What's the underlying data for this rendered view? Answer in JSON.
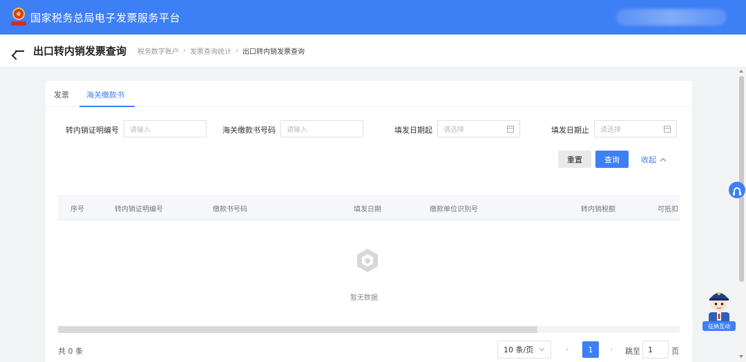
{
  "header": {
    "app_title": "国家税务总局电子发票服务平台"
  },
  "page": {
    "title": "出口转内销发票查询",
    "breadcrumb": [
      "税务数字账户",
      "发票查询统计",
      "出口转内销发票查询"
    ]
  },
  "tabs": [
    {
      "label": "发票",
      "active": false
    },
    {
      "label": "海关缴款书",
      "active": true
    }
  ],
  "filters": {
    "transfer_cert_no": {
      "label": "转内销证明编号",
      "placeholder": "请输入"
    },
    "customs_payment_no": {
      "label": "海关缴款书号码",
      "placeholder": "请输入"
    },
    "issue_date_start": {
      "label": "填发日期起",
      "placeholder": "请选择"
    },
    "issue_date_end": {
      "label": "填发日期止",
      "placeholder": "请选择"
    }
  },
  "actions": {
    "reset": "重置",
    "query": "查询",
    "collapse": "收起"
  },
  "table": {
    "columns": [
      "序号",
      "转内销证明编号",
      "缴款书号码",
      "填发日期",
      "缴款单位识别号",
      "转内销税额",
      "可抵扣"
    ],
    "rows": [],
    "empty_text": "暂无数据"
  },
  "pagination": {
    "total_text": "共 0 条",
    "page_size": "10 条/页",
    "current_page": "1",
    "jump_label": "跳至",
    "jump_value": "1",
    "page_unit": "页"
  },
  "assistant": {
    "label": "征纳互动"
  },
  "colors": {
    "primary": "#3d7ff5",
    "reset_bg": "#e8e9eb"
  }
}
